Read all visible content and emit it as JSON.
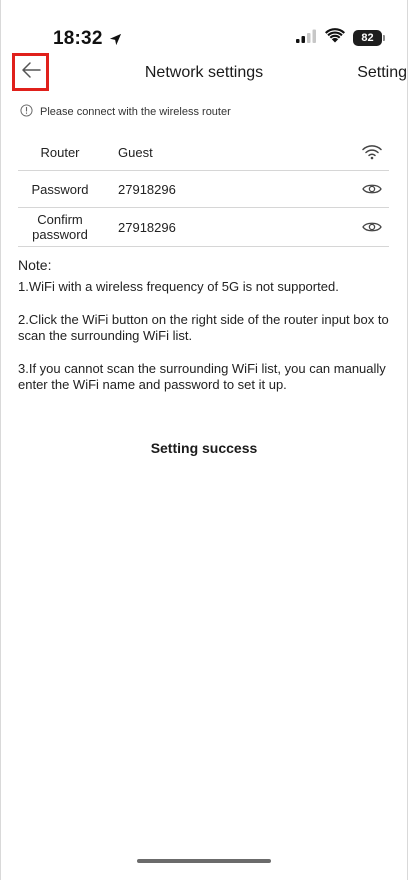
{
  "status_bar": {
    "time": "18:32",
    "battery": "82",
    "icons": [
      "location-arrow-icon",
      "signal-icon",
      "wifi-icon",
      "battery-icon"
    ]
  },
  "header": {
    "title": "Network settings",
    "right_action": "Setting",
    "back_icon": "arrow-left-icon"
  },
  "hint": {
    "icon": "info-circle-icon",
    "text": "Please connect with the wireless router"
  },
  "form": {
    "router": {
      "label": "Router",
      "value": "Guest",
      "icon": "wifi-icon"
    },
    "password": {
      "label": "Password",
      "value": "27918296",
      "icon": "eye-icon"
    },
    "confirm": {
      "label_line1": "Confirm",
      "label_line2": "password",
      "value": "27918296",
      "icon": "eye-icon"
    }
  },
  "notes": {
    "title": "Note:",
    "items": [
      "1.WiFi with a wireless frequency of 5G is not supported.",
      "2.Click the WiFi button on the right side of the router input box to scan the surrounding WiFi list.",
      "3.If you cannot scan the surrounding WiFi list, you can manually enter the WiFi name and password to set it up."
    ]
  },
  "status_message": "Setting success",
  "colors": {
    "highlight": "#e0201b",
    "divider": "#d6d6d6",
    "text": "#1b1b1b"
  }
}
